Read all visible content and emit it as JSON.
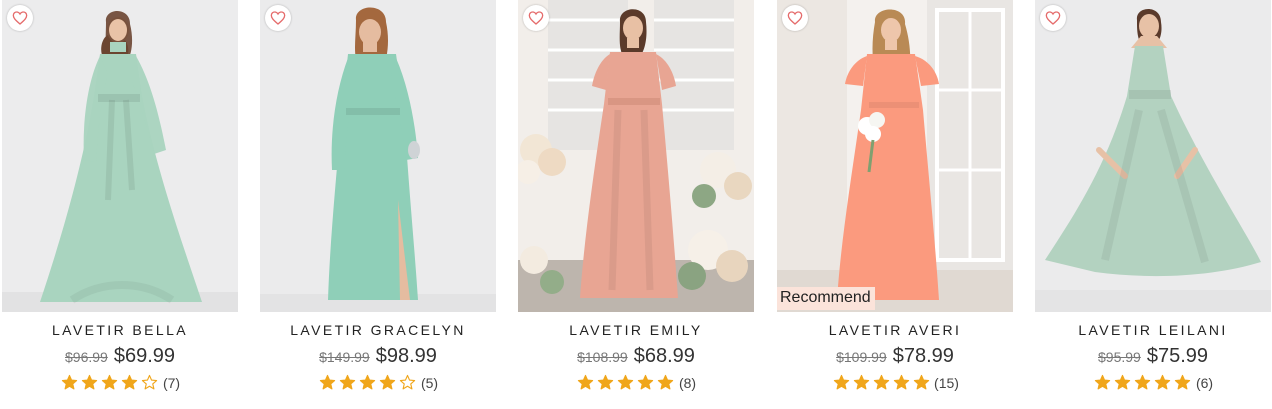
{
  "colors": {
    "star": "#f0a61b",
    "heart": "#e56b6b",
    "badge_bg": "#fbe3da"
  },
  "icons": {
    "favorite": "heart-outline-icon",
    "star_full": "star-filled-icon",
    "star_empty": "star-outline-icon"
  },
  "products": [
    {
      "name": "LAVETIR BELLA",
      "original_price": "$96.99",
      "sale_price": "$69.99",
      "rating": 4,
      "review_count": "(7)",
      "badge": "",
      "dress_color": "#a9d4bf"
    },
    {
      "name": "LAVETIR GRACELYN",
      "original_price": "$149.99",
      "sale_price": "$98.99",
      "rating": 4,
      "review_count": "(5)",
      "badge": "",
      "dress_color": "#8fcfb8"
    },
    {
      "name": "LAVETIR EMILY",
      "original_price": "$108.99",
      "sale_price": "$68.99",
      "rating": 5,
      "review_count": "(8)",
      "badge": "",
      "dress_color": "#e8a593"
    },
    {
      "name": "LAVETIR AVERI",
      "original_price": "$109.99",
      "sale_price": "$78.99",
      "rating": 5,
      "review_count": "(15)",
      "badge": "Recommend",
      "dress_color": "#fb9a7e"
    },
    {
      "name": "LAVETIR LEILANI",
      "original_price": "$95.99",
      "sale_price": "$75.99",
      "rating": 5,
      "review_count": "(6)",
      "badge": "",
      "dress_color": "#b3d2c0"
    }
  ]
}
